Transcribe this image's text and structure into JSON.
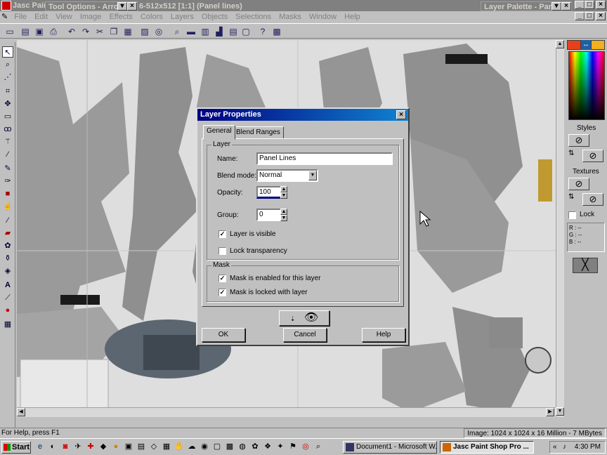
{
  "window": {
    "title_left": "Jasc Pain",
    "title_right": "6-512x512 [1:1] (Panel lines)"
  },
  "tool_options": {
    "title": "Tool Options - Arrow"
  },
  "layer_palette": {
    "title": "Layer Palette - Pane"
  },
  "menu": [
    "File",
    "Edit",
    "View",
    "Image",
    "Effects",
    "Colors",
    "Layers",
    "Objects",
    "Selections",
    "Masks",
    "Window",
    "Help"
  ],
  "right_panel": {
    "styles": "Styles",
    "textures": "Textures",
    "lock": "Lock",
    "r": "R :",
    "g": "G :",
    "b": "B :",
    "dashes": "--"
  },
  "status": {
    "left": "For Help, press F1",
    "right": "Image:  1024 x 1024 x 16 Million - 7 MBytes"
  },
  "taskbar": {
    "start": "Start",
    "item1": "Document1 - Microsoft W...",
    "item2": "Jasc Paint Shop Pro ...",
    "clock": "4:30 PM"
  },
  "dialog": {
    "title": "Layer Properties",
    "tabs": [
      "General",
      "Blend Ranges"
    ],
    "layer_group": "Layer",
    "name_label": "Name:",
    "name_value": "Panel Lines",
    "blend_label": "Blend mode:",
    "blend_value": "Normal",
    "opacity_label": "Opacity:",
    "opacity_value": "100",
    "group_label": "Group:",
    "group_value": "0",
    "visible_label": "Layer is visible",
    "visible": true,
    "lock_label": "Lock transparency",
    "lock": false,
    "mask_group": "Mask",
    "mask_enabled_label": "Mask is enabled for this layer",
    "mask_enabled": true,
    "mask_locked_label": "Mask is locked with layer",
    "mask_locked": true,
    "ok": "OK",
    "cancel": "Cancel",
    "help": "Help"
  },
  "colors": {
    "foreground": "#e8401c",
    "background": "#f0b020",
    "dialog_title": "#000080"
  }
}
